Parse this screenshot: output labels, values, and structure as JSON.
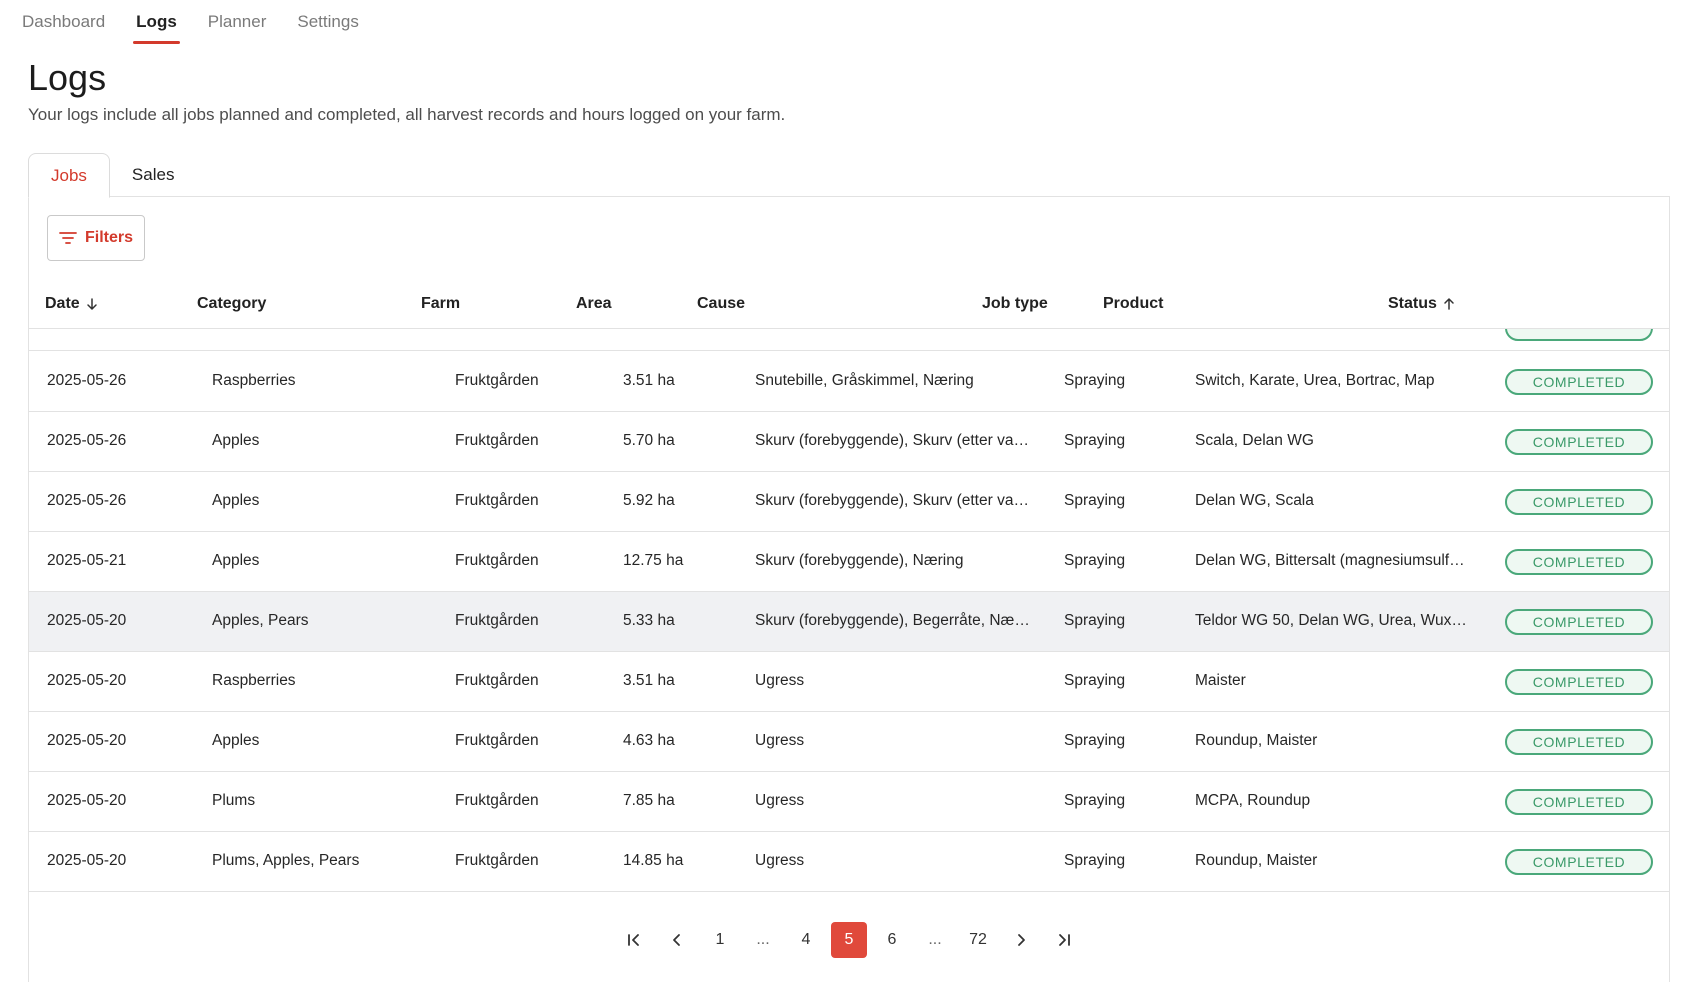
{
  "nav": {
    "items": [
      {
        "label": "Dashboard"
      },
      {
        "label": "Logs"
      },
      {
        "label": "Planner"
      },
      {
        "label": "Settings"
      }
    ]
  },
  "page": {
    "title": "Logs",
    "description": "Your logs include all jobs planned and completed, all harvest records and hours logged on your farm."
  },
  "tabs": [
    {
      "label": "Jobs"
    },
    {
      "label": "Sales"
    }
  ],
  "toolbar": {
    "filters_label": "Filters"
  },
  "table": {
    "headers": {
      "date": "Date",
      "category": "Category",
      "farm": "Farm",
      "area": "Area",
      "cause": "Cause",
      "job_type": "Job type",
      "product": "Product",
      "status": "Status"
    },
    "rows": [
      {
        "date": "2025-05-26",
        "category": "Raspberries",
        "farm": "Fruktgården",
        "area": "3.51 ha",
        "cause": "Snutebille, Gråskimmel, Næring",
        "job_type": "Spraying",
        "product": "Switch, Karate, Urea, Bortrac, Map",
        "status": "COMPLETED"
      },
      {
        "date": "2025-05-26",
        "category": "Apples",
        "farm": "Fruktgården",
        "area": "5.70 ha",
        "cause": "Skurv (forebyggende), Skurv (etter vars...",
        "job_type": "Spraying",
        "product": "Scala, Delan WG",
        "status": "COMPLETED"
      },
      {
        "date": "2025-05-26",
        "category": "Apples",
        "farm": "Fruktgården",
        "area": "5.92 ha",
        "cause": "Skurv (forebyggende), Skurv (etter vars...",
        "job_type": "Spraying",
        "product": "Delan WG, Scala",
        "status": "COMPLETED"
      },
      {
        "date": "2025-05-21",
        "category": "Apples",
        "farm": "Fruktgården",
        "area": "12.75 ha",
        "cause": "Skurv (forebyggende), Næring",
        "job_type": "Spraying",
        "product": "Delan WG, Bittersalt (magnesiumsulfat...",
        "status": "COMPLETED"
      },
      {
        "date": "2025-05-20",
        "category": "Apples, Pears",
        "farm": "Fruktgården",
        "area": "5.33 ha",
        "cause": "Skurv (forebyggende), Begerråte, Næring",
        "job_type": "Spraying",
        "product": "Teldor WG 50, Delan WG, Urea, Wuxal ...",
        "status": "COMPLETED"
      },
      {
        "date": "2025-05-20",
        "category": "Raspberries",
        "farm": "Fruktgården",
        "area": "3.51 ha",
        "cause": "Ugress",
        "job_type": "Spraying",
        "product": "Maister",
        "status": "COMPLETED"
      },
      {
        "date": "2025-05-20",
        "category": "Apples",
        "farm": "Fruktgården",
        "area": "4.63 ha",
        "cause": "Ugress",
        "job_type": "Spraying",
        "product": "Roundup, Maister",
        "status": "COMPLETED"
      },
      {
        "date": "2025-05-20",
        "category": "Plums",
        "farm": "Fruktgården",
        "area": "7.85 ha",
        "cause": "Ugress",
        "job_type": "Spraying",
        "product": "MCPA, Roundup",
        "status": "COMPLETED"
      },
      {
        "date": "2025-05-20",
        "category": "Plums, Apples, Pears",
        "farm": "Fruktgården",
        "area": "14.85 ha",
        "cause": "Ugress",
        "job_type": "Spraying",
        "product": "Roundup, Maister",
        "status": "COMPLETED"
      }
    ]
  },
  "pagination": {
    "pages": [
      "1",
      "...",
      "4",
      "5",
      "6",
      "...",
      "72"
    ],
    "current": "5"
  },
  "colors": {
    "accent": "#d33a2c",
    "status_completed": "#3a9a69",
    "row_hover": "#f0f1f3"
  }
}
